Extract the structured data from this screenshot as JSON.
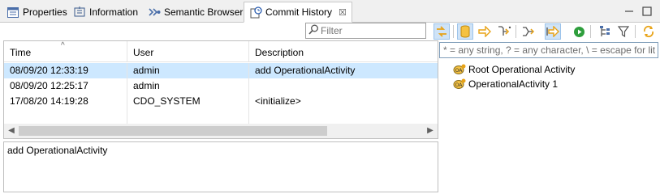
{
  "tabs": [
    {
      "label": "Properties",
      "icon": "properties-icon"
    },
    {
      "label": "Information",
      "icon": "information-icon"
    },
    {
      "label": "Semantic Browser",
      "icon": "semantic-browser-icon"
    },
    {
      "label": "Commit History",
      "icon": "commit-history-icon",
      "active": true
    }
  ],
  "tab_close": "☒",
  "filter": {
    "placeholder": "Filter",
    "value": ""
  },
  "table": {
    "columns": [
      "Time",
      "User",
      "Description"
    ],
    "rows": [
      {
        "time": "08/09/20 12:33:19",
        "user": "admin",
        "description": "add OperationalActivity",
        "selected": true
      },
      {
        "time": "08/09/20 12:25:17",
        "user": "admin",
        "description": ""
      },
      {
        "time": "17/08/20 14:19:28",
        "user": "CDO_SYSTEM",
        "description": "<initialize>"
      }
    ]
  },
  "detail_text": "add OperationalActivity",
  "right": {
    "filter_placeholder": "* = any string, ? = any character, \\ = escape for lit",
    "tree": [
      "Root Operational Activity",
      "OperationalActivity 1"
    ]
  },
  "colors": {
    "selection": "#cde8ff",
    "accent_toggle": "#cfe3f7",
    "icon_orange": "#e8a317",
    "icon_green": "#2e9e3c"
  }
}
